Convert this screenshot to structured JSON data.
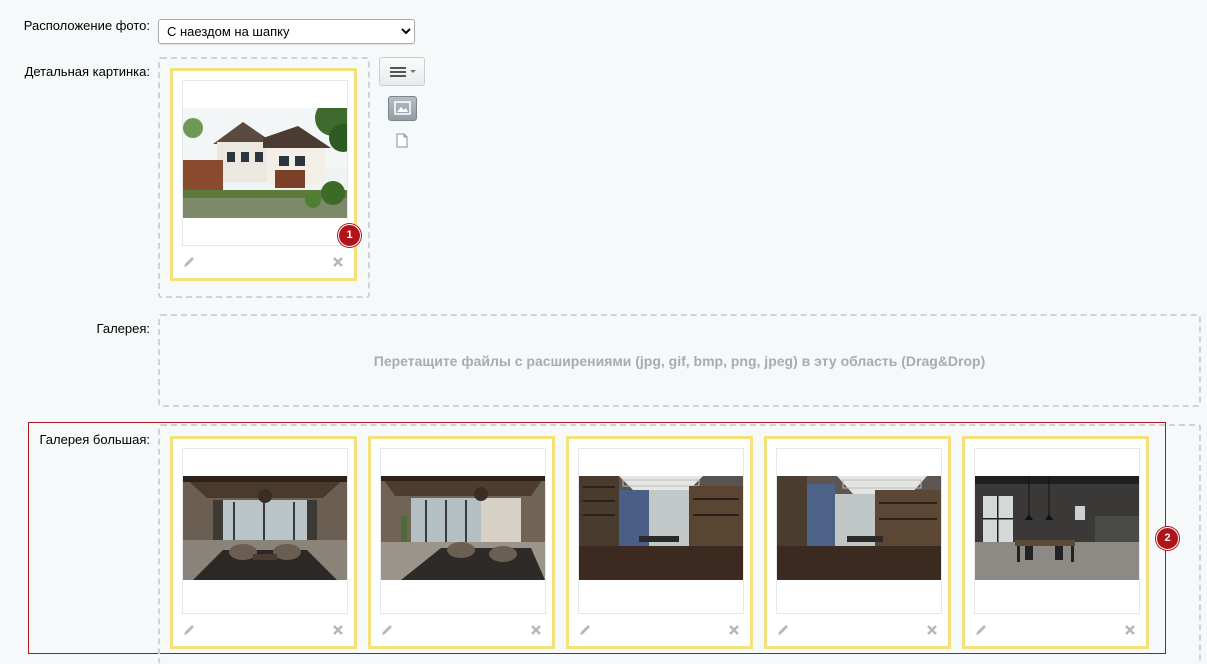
{
  "fields": {
    "photo_position": {
      "label": "Расположение фото:",
      "selected": "С наездом на шапку"
    },
    "detail_picture": {
      "label": "Детальная картинка:",
      "badge": "1"
    },
    "gallery": {
      "label": "Галерея:",
      "drop_hint": "Перетащите файлы с расширениями (jpg, gif, bmp, png, jpeg) в эту область (Drag&Drop)"
    },
    "gallery_big": {
      "label": "Галерея большая:",
      "badge": "2"
    }
  },
  "images": {
    "detail": {
      "name": "house-exterior"
    },
    "gallery_big": [
      {
        "name": "living-room-1"
      },
      {
        "name": "living-room-2"
      },
      {
        "name": "office-1"
      },
      {
        "name": "office-2"
      },
      {
        "name": "dining-loft"
      }
    ]
  },
  "icons": {
    "menu": "hamburger-icon",
    "image_mode": "image-icon",
    "file_mode": "file-icon",
    "edit": "pencil-icon",
    "delete": "close-icon"
  },
  "colors": {
    "background": "#f5f9f9",
    "card_border": "#f5e07e",
    "highlight": "#b0141b",
    "drop_text": "#a5acb3"
  }
}
